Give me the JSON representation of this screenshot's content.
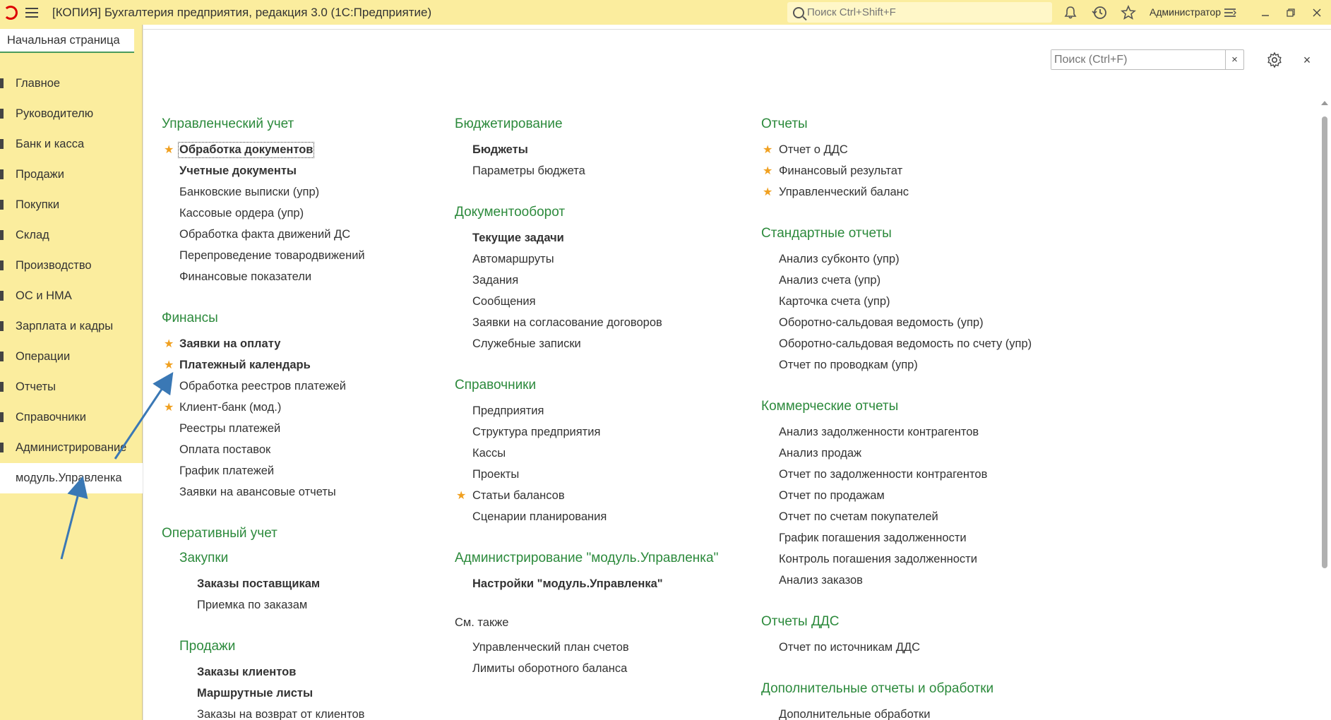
{
  "titlebar": {
    "title": "[КОПИЯ] Бухгалтерия предприятия, редакция 3.0  (1С:Предприятие)",
    "search_placeholder": "Поиск Ctrl+Shift+F",
    "user": "Администратор",
    "icons": [
      "1c-logo-icon",
      "menu-icon",
      "search-icon",
      "bell-icon",
      "history-icon",
      "star-icon",
      "settings-lines-icon",
      "minimize-icon",
      "restore-icon",
      "close-icon"
    ],
    "bg_color": "#fbed9e"
  },
  "sidebar": {
    "home_tab": "Начальная страница",
    "items": [
      {
        "label": "Главное"
      },
      {
        "label": "Руководителю"
      },
      {
        "label": "Банк и касса"
      },
      {
        "label": "Продажи"
      },
      {
        "label": "Покупки"
      },
      {
        "label": "Склад"
      },
      {
        "label": "Производство"
      },
      {
        "label": "ОС и НМА"
      },
      {
        "label": "Зарплата и кадры"
      },
      {
        "label": "Операции"
      },
      {
        "label": "Отчеты"
      },
      {
        "label": "Справочники"
      },
      {
        "label": "Администрирование"
      },
      {
        "label": "модуль.Управленка"
      }
    ]
  },
  "content": {
    "search_placeholder": "Поиск (Ctrl+F)",
    "clear_label": "×",
    "close_label": "×",
    "accent_color": "#2c8a3c",
    "star_color": "#f0a020",
    "col1": {
      "upr_title": "Управленческий учет",
      "upr_items": [
        "Обработка документов",
        "Учетные документы",
        "Банковские выписки  (упр)",
        "Кассовые ордера  (упр)",
        "Обработка факта движений ДС",
        "Перепроведение товародвижений",
        "Финансовые показатели"
      ],
      "fin_title": "Финансы",
      "fin_items": [
        "Заявки на оплату",
        "Платежный календарь",
        "Обработка реестров платежей",
        "Клиент-банк (мод.)",
        "Реестры платежей",
        "Оплата поставок",
        "График платежей",
        "Заявки на авансовые отчеты"
      ],
      "oper_title": "Оперативный учет",
      "zak_title": "Закупки",
      "zak_items": [
        "Заказы поставщикам",
        "Приемка по заказам"
      ],
      "prod_title": "Продажи",
      "prod_items": [
        "Заказы клиентов",
        "Маршрутные листы",
        "Заказы на возврат от клиентов"
      ]
    },
    "col2": {
      "bud_title": "Бюджетирование",
      "bud_items": [
        "Бюджеты",
        "Параметры бюджета"
      ],
      "doc_title": "Документооборот",
      "doc_items": [
        "Текущие задачи",
        "Автомаршруты",
        "Задания",
        "Сообщения",
        "Заявки на согласование договоров",
        "Служебные записки"
      ],
      "spr_title": "Справочники",
      "spr_items": [
        "Предприятия",
        "Структура предприятия",
        "Кассы",
        "Проекты",
        "Статьи балансов",
        "Сценарии планирования"
      ],
      "adm_title": "Администрирование \"модуль.Управленка\"",
      "adm_items": [
        "Настройки \"модуль.Управленка\""
      ],
      "see_also": "См. также",
      "see_items": [
        "Управленческий план счетов",
        "Лимиты оборотного баланса"
      ]
    },
    "col3": {
      "rep_title": "Отчеты",
      "rep_items": [
        "Отчет о ДДС",
        "Финансовый результат",
        "Управленческий баланс"
      ],
      "std_title": "Стандартные отчеты",
      "std_items": [
        "Анализ субконто (упр)",
        "Анализ счета (упр)",
        "Карточка счета (упр)",
        "Оборотно-сальдовая ведомость (упр)",
        "Оборотно-сальдовая ведомость по счету (упр)",
        "Отчет по проводкам (упр)"
      ],
      "com_title": "Коммерческие отчеты",
      "com_items": [
        "Анализ задолженности контрагентов",
        "Анализ продаж",
        "Отчет по задолженности контрагентов",
        "Отчет по продажам",
        "Отчет по счетам покупателей",
        "График погашения задолженности",
        "Контроль погашения задолженности",
        "Анализ заказов"
      ],
      "dds_title": "Отчеты ДДС",
      "dds_items": [
        "Отчет по источникам ДДС"
      ],
      "add_title": "Дополнительные отчеты и обработки",
      "add_items": [
        "Дополнительные обработки"
      ]
    }
  },
  "annotation_color": "#3a78b5"
}
